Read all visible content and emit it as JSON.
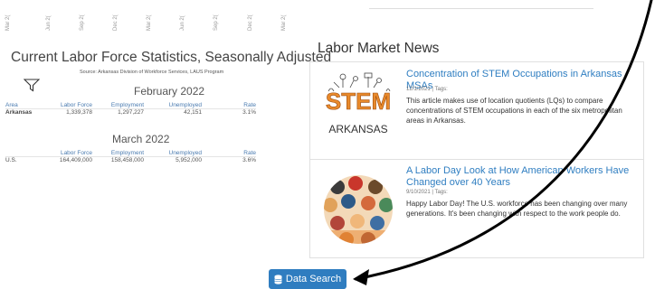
{
  "chart_axis": {
    "ticks": [
      "Mar 2(",
      "Jun 2(",
      "Sep 2(",
      "Dec 2(",
      "Mar 2(",
      "Jun 2(",
      "Sep 2(",
      "Dec 2(",
      "Mar 2("
    ]
  },
  "labor": {
    "title": "Current Labor Force Statistics, Seasonally Adjusted",
    "source": "Source: Arkansas Division of Workforce Services, LAUS Program",
    "filter_icon": "funnel-icon",
    "tables": [
      {
        "period": "February 2022",
        "headers": [
          "Area",
          "Labor Force",
          "Employment",
          "Unemployed",
          "Rate"
        ],
        "row": [
          "Arkansas",
          "1,339,378",
          "1,297,227",
          "42,151",
          "3.1%"
        ]
      },
      {
        "period": "March 2022",
        "headers": [
          "",
          "Labor Force",
          "Employment",
          "Unemployed",
          "Rate"
        ],
        "row": [
          "U.S.",
          "164,409,000",
          "158,458,000",
          "5,952,000",
          "3.6%"
        ]
      }
    ]
  },
  "news": {
    "title": "Labor Market News",
    "articles": [
      {
        "title": "Concentration of STEM Occupations in Arkansas MSAs",
        "meta": "12/1/2021 | Tags:",
        "summary": "This article makes use of location quotients (LQs) to compare concentrations of STEM occupations in each of the six metropolitan areas in Arkansas.",
        "image_text_1": "STEM",
        "image_text_2": "ARKANSAS"
      },
      {
        "title": "A Labor Day Look at How American Workers Have Changed over 40 Years",
        "meta": "9/10/2021 | Tags:",
        "summary": "Happy Labor Day! The U.S. workforce has been changing over many generations. It's been changing with respect to the work people do."
      }
    ]
  },
  "button": {
    "label": "Data Search",
    "icon": "database-icon"
  },
  "colors": {
    "accent": "#2f7dc0",
    "link": "#2f7ec1",
    "header_blue": "#4a7bb0"
  }
}
